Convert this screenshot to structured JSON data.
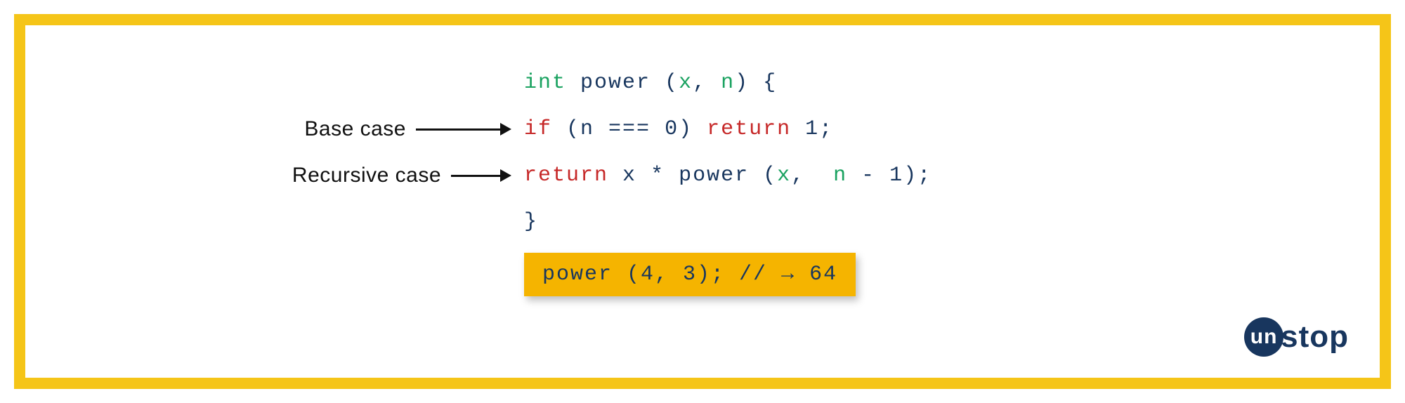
{
  "labels": {
    "base": "Base case",
    "recursive": "Recursive case"
  },
  "code": {
    "l1_type": "int",
    "l1_name": "power",
    "l1_open": " (",
    "l1_p1": "x",
    "l1_comma": ", ",
    "l1_p2": "n",
    "l1_close": ") {",
    "l2_kw": "if",
    "l2_open": " (",
    "l2_var": "n",
    "l2_eq": " === ",
    "l2_zero": "0",
    "l2_close": ") ",
    "l2_ret": "return",
    "l2_val": " 1",
    "l2_semi": ";",
    "l3_ret": "return",
    "l3_sp1": " ",
    "l3_x": "x",
    "l3_mul": " * ",
    "l3_name": "power",
    "l3_open": " (",
    "l3_p1": "x",
    "l3_comma": ",  ",
    "l3_p2": "n",
    "l3_minus": " - ",
    "l3_one": "1",
    "l3_close": ");",
    "l4_brace": "}"
  },
  "result": {
    "call": "power (4, 3); // ",
    "arrow": "→",
    "value": " 64"
  },
  "logo": {
    "circle": "un",
    "rest": "stop"
  }
}
